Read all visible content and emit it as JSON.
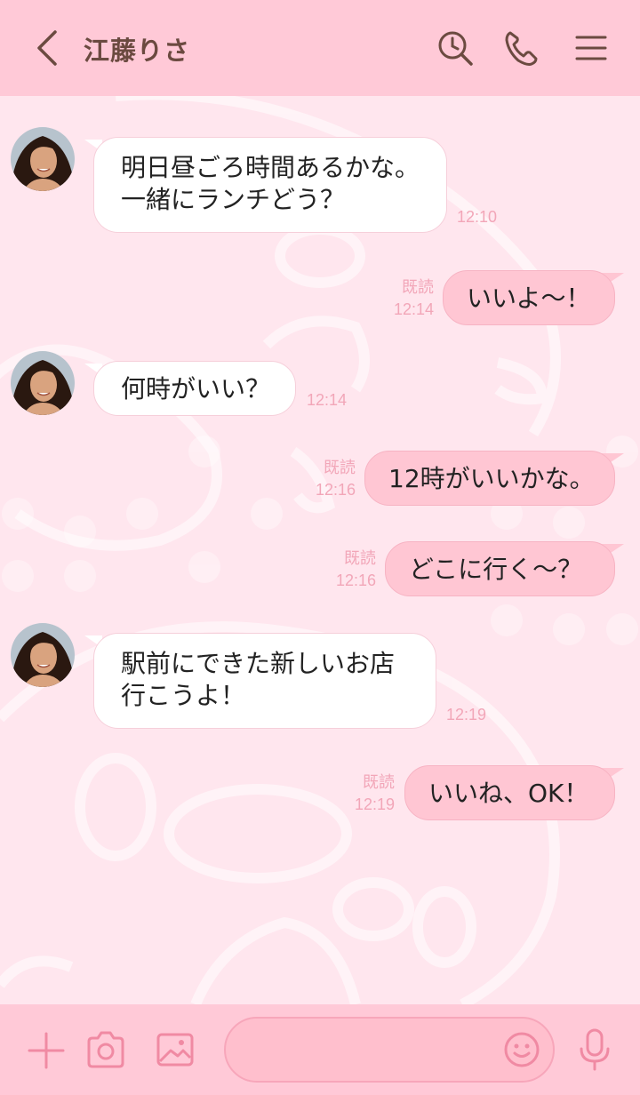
{
  "header": {
    "title": "江藤りさ",
    "icons": [
      "back-chevron-icon",
      "search-history-icon",
      "phone-icon",
      "menu-icon"
    ]
  },
  "messages": [
    {
      "side": "in",
      "text": "明日昼ごろ時間あるかな。\n一緒にランチどう？",
      "time": "12:10"
    },
    {
      "side": "out",
      "text": "いいよ～！",
      "read": "既読",
      "time": "12:14"
    },
    {
      "side": "in",
      "text": "何時がいい？",
      "time": "12:14"
    },
    {
      "side": "out",
      "text": "12時がいいかな。",
      "read": "既読",
      "time": "12:16"
    },
    {
      "side": "out",
      "text": "どこに行く～？",
      "read": "既読",
      "time": "12:16"
    },
    {
      "side": "in",
      "text": "駅前にできた新しいお店\n行こうよ！",
      "time": "12:19"
    },
    {
      "side": "out",
      "text": "いいね、OK！",
      "read": "既読",
      "time": "12:19"
    }
  ],
  "footer": {
    "message_placeholder": "",
    "icons": [
      "plus-icon",
      "camera-icon",
      "image-icon",
      "emoji-icon",
      "microphone-icon"
    ]
  },
  "colors": {
    "header_bg": "#ffc9d7",
    "chat_bg": "#ffe6ee",
    "outgoing_bubble": "#ffc6d3",
    "incoming_bubble": "#ffffff",
    "time_text": "#f2a6b8",
    "title_text": "#6b4a40"
  }
}
